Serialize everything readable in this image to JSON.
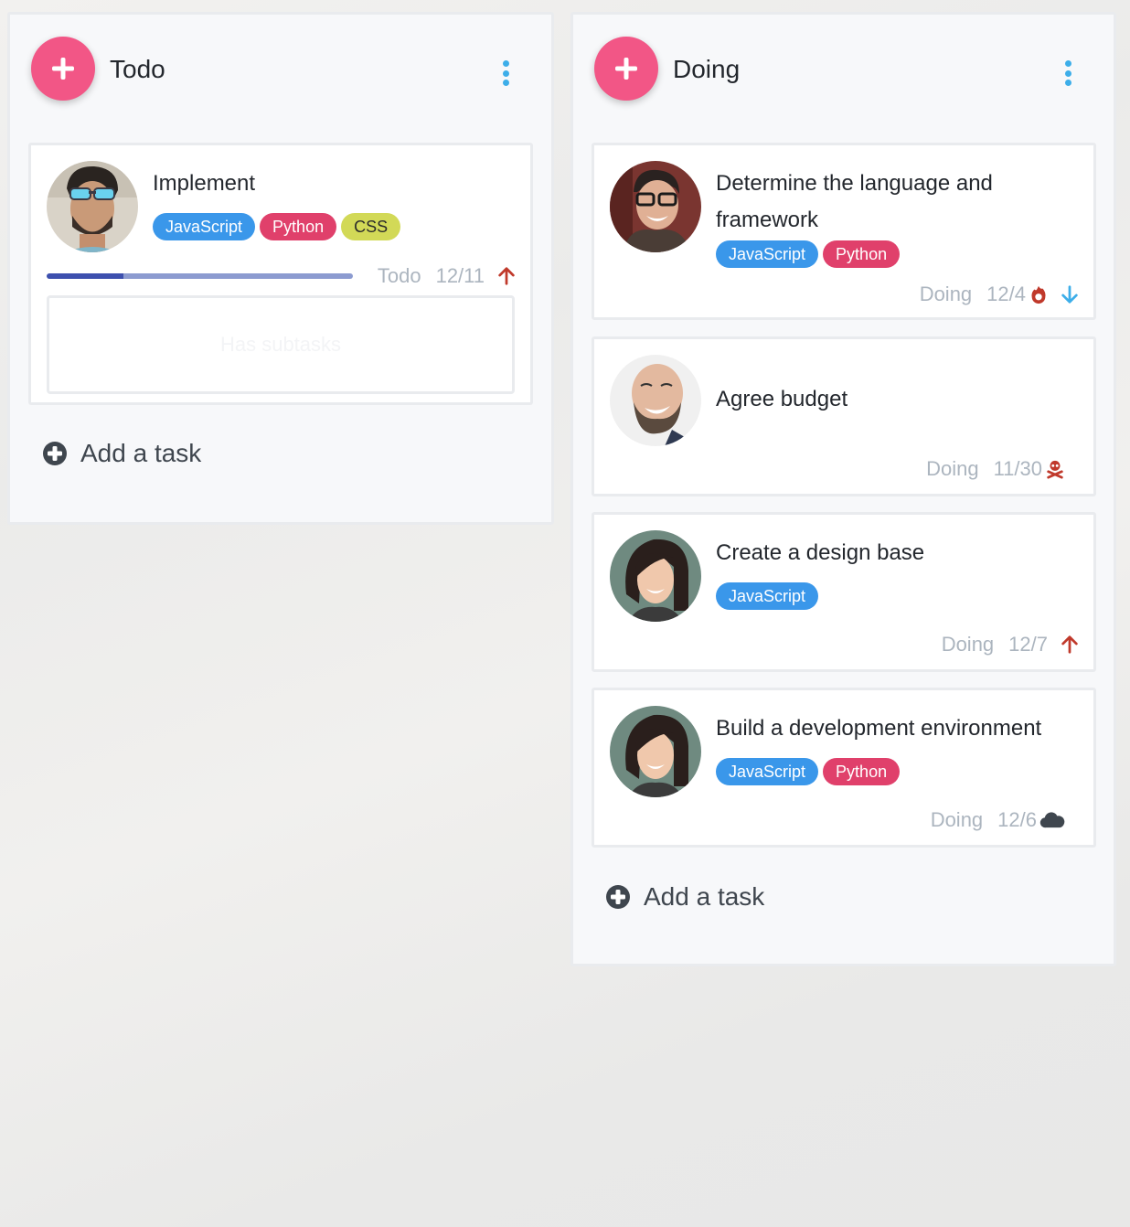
{
  "columns": [
    {
      "title": "Todo",
      "add_task_label": "Add a task",
      "cards": [
        {
          "title": "Implement",
          "tags": [
            {
              "label": "JavaScript",
              "color": "#3a97ea"
            },
            {
              "label": "Python",
              "color": "#e0406b"
            },
            {
              "label": "CSS",
              "color": "#d2d957"
            }
          ],
          "status": "Todo",
          "date": "12/11",
          "priority_icon": "arrow-up-icon",
          "progress_fraction": 0.25,
          "subtasks_placeholder": "Has subtasks",
          "avatar": "man-with-blue-sunglasses"
        }
      ]
    },
    {
      "title": "Doing",
      "add_task_label": "Add a task",
      "cards": [
        {
          "title": "Determine the language and framework",
          "tags": [
            {
              "label": "JavaScript",
              "color": "#3a97ea"
            },
            {
              "label": "Python",
              "color": "#e0406b"
            }
          ],
          "status": "Doing",
          "date": "12/4",
          "due_icon": "fire-icon",
          "priority_icon": "arrow-down-icon",
          "avatar": "young-man-with-glasses"
        },
        {
          "title": "Agree budget",
          "tags": [],
          "status": "Doing",
          "date": "11/30",
          "due_icon": "skull-crossbones-icon",
          "avatar": "bald-bearded-man-laughing"
        },
        {
          "title": "Create a design base",
          "tags": [
            {
              "label": "JavaScript",
              "color": "#3a97ea"
            }
          ],
          "status": "Doing",
          "date": "12/7",
          "priority_icon": "arrow-up-icon",
          "avatar": "smiling-woman-dark-hair"
        },
        {
          "title": "Build a development environment",
          "tags": [
            {
              "label": "JavaScript",
              "color": "#3a97ea"
            },
            {
              "label": "Python",
              "color": "#e0406b"
            }
          ],
          "status": "Doing",
          "date": "12/6",
          "due_icon": "cloud-icon",
          "avatar": "smiling-woman-dark-hair"
        }
      ]
    }
  ],
  "colors": {
    "fab": "#f25686",
    "kebab": "#3daee9",
    "priority_up": "#c0392b",
    "priority_down": "#3daee9",
    "progress_fill": "#3d50ae",
    "progress_track": "#8c9bd0"
  }
}
